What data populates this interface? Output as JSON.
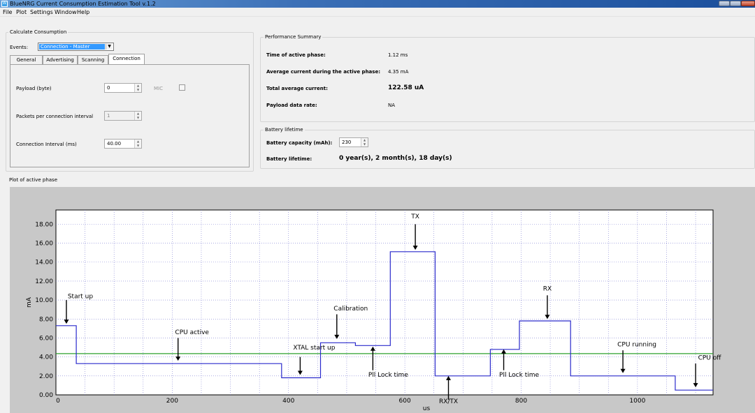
{
  "window": {
    "title": "BlueNRG Current Consumption Estimation Tool v.1.2",
    "icon_text": "W"
  },
  "menu": [
    "File",
    "Plot",
    "Settings",
    "Window",
    "Help"
  ],
  "calc": {
    "title": "Calculate Consumption",
    "events_label": "Events:",
    "events_value": "Connection - Master",
    "tabs": [
      "General",
      "Advertising",
      "Scanning",
      "Connection"
    ],
    "active_tab": "Connection",
    "payload_label": "Payload (byte)",
    "payload_value": "0",
    "mic_label": "MIC",
    "packets_label": "Packets per connection interval",
    "packets_value": "1",
    "interval_label": "Connection Interval (ms)",
    "interval_value": "40.00"
  },
  "performance": {
    "title": "Performance Summary",
    "rows": [
      {
        "label": "Time of active phase:",
        "value": "1.12 ms"
      },
      {
        "label": "Average current during the active phase:",
        "value": "4.35 mA"
      },
      {
        "label": "Total average current:",
        "value": "122.58 uA"
      },
      {
        "label": "Payload data rate:",
        "value": "NA"
      }
    ]
  },
  "battery": {
    "title": "Battery lifetime",
    "capacity_label": "Battery capacity (mAh):",
    "capacity_value": "230",
    "lifetime_label": "Battery lifetime:",
    "lifetime_value": "0 year(s), 2 month(s), 18 day(s)"
  },
  "plot_panel": {
    "title": "Plot of active phase"
  },
  "colors": {
    "step_line": "#2a2acc",
    "average_line": "#2ca02c",
    "grid": "#7a7ad0",
    "plot_bg": "#ffffff",
    "outer_bg": "#c8c8c8"
  },
  "chart_data": {
    "type": "line",
    "xlabel": "us",
    "ylabel": "mA",
    "xlim": [
      0,
      1130
    ],
    "ylim": [
      0,
      19.5
    ],
    "xticks": [
      0,
      200,
      400,
      600,
      800,
      1000
    ],
    "yticks": [
      0,
      2,
      4,
      6,
      8,
      10,
      12,
      14,
      16,
      18
    ],
    "ytick_labels": [
      "0.00",
      "2.00",
      "4.00",
      "6.00",
      "8.00",
      "10.00",
      "12.00",
      "14.00",
      "16.00",
      "18.00"
    ],
    "grid": true,
    "series": [
      {
        "name": "",
        "step": true,
        "x": [
          0,
          35,
          35,
          388,
          388,
          455,
          455,
          515,
          515,
          575,
          575,
          652,
          652,
          747,
          747,
          797,
          797,
          885,
          885,
          1065,
          1065,
          1130
        ],
        "y": [
          7.3,
          7.3,
          3.3,
          3.3,
          1.8,
          1.8,
          5.5,
          5.5,
          5.2,
          5.2,
          15.1,
          15.1,
          2.0,
          2.0,
          4.8,
          4.8,
          7.8,
          7.8,
          2.0,
          2.0,
          0.5,
          0.5
        ]
      },
      {
        "name": "",
        "x": [
          0,
          1130
        ],
        "y": [
          4.35,
          4.35
        ]
      }
    ],
    "annotations": [
      {
        "text": "Start up",
        "x": 18,
        "y": 10.2,
        "arrow_from": 10.0,
        "arrow_to": 7.5,
        "direction": "down"
      },
      {
        "text": "CPU active",
        "x": 210,
        "y": 6.4,
        "arrow_from": 6.0,
        "arrow_to": 3.6,
        "direction": "down"
      },
      {
        "text": "XTAL start up",
        "x": 420,
        "y": 4.8,
        "arrow_from": 4.0,
        "arrow_to": 2.1,
        "direction": "down"
      },
      {
        "text": "Calibration",
        "x": 483,
        "y": 8.9,
        "arrow_from": 8.5,
        "arrow_to": 5.9,
        "direction": "down"
      },
      {
        "text": "Pll Lock time",
        "x": 545,
        "y": 1.9,
        "arrow_from": 2.6,
        "arrow_to": 5.1,
        "direction": "up"
      },
      {
        "text": "TX",
        "x": 618,
        "y": 18.6,
        "arrow_from": 18.0,
        "arrow_to": 15.3,
        "direction": "down"
      },
      {
        "text": "RX/TX",
        "x": 675,
        "y": -0.8,
        "arrow_from": -0.5,
        "arrow_to": 2.0,
        "direction": "up"
      },
      {
        "text": "Pll Lock time",
        "x": 770,
        "y": 1.9,
        "arrow_from": 2.6,
        "arrow_to": 4.8,
        "direction": "up"
      },
      {
        "text": "RX",
        "x": 845,
        "y": 11.0,
        "arrow_from": 10.5,
        "arrow_to": 8.0,
        "direction": "down"
      },
      {
        "text": "CPU running",
        "x": 975,
        "y": 5.1,
        "arrow_from": 4.7,
        "arrow_to": 2.3,
        "direction": "down"
      },
      {
        "text": "CPU off",
        "x": 1100,
        "y": 3.7,
        "arrow_from": 3.3,
        "arrow_to": 0.8,
        "direction": "down"
      }
    ]
  }
}
